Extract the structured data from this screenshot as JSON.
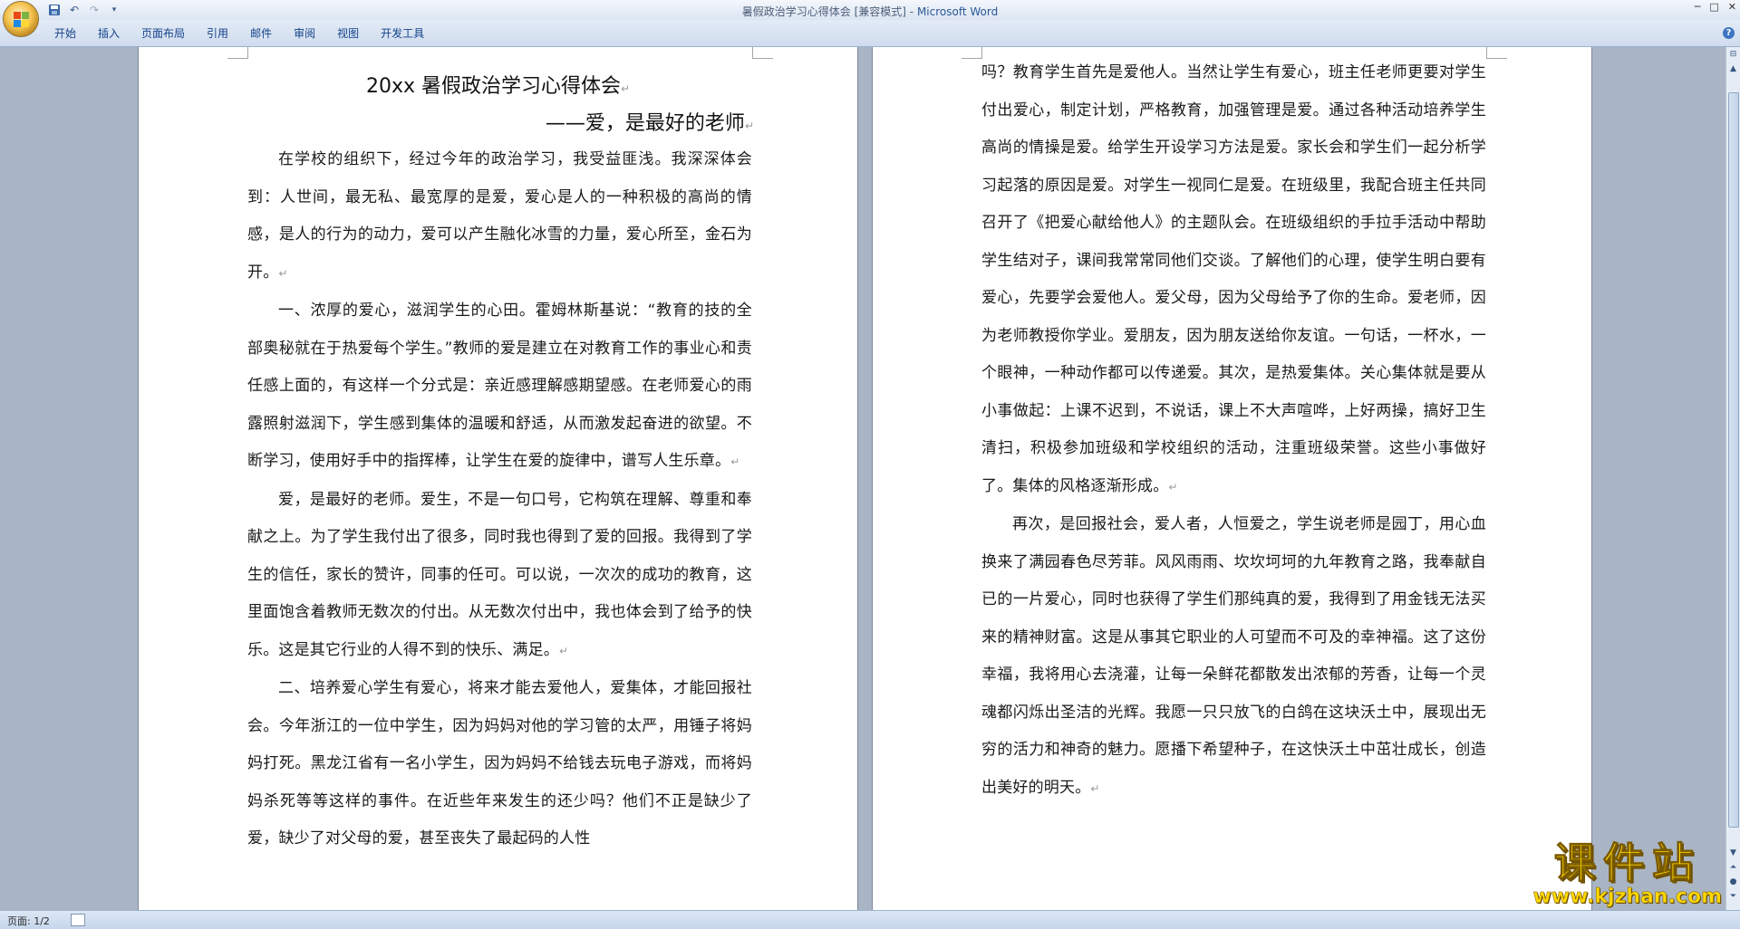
{
  "window": {
    "title": "暑假政治学习心得体会 [兼容模式]",
    "title_separator": " - ",
    "app_name": "Microsoft Word"
  },
  "ribbon_tabs": [
    "开始",
    "插入",
    "页面布局",
    "引用",
    "邮件",
    "审阅",
    "视图",
    "开发工具"
  ],
  "page1": {
    "title": "20xx 暑假政治学习心得体会",
    "subtitle": "——爱，是最好的老师",
    "paragraphs": [
      "在学校的组织下，经过今年的政治学习，我受益匪浅。我深深体会到：人世间，最无私、最宽厚的是爱，爱心是人的一种积极的高尚的情感，是人的行为的动力，爱可以产生融化冰雪的力量，爱心所至，金石为开。",
      "一、浓厚的爱心，滋润学生的心田。霍姆林斯基说：“教育的技的全部奥秘就在于热爱每个学生。”教师的爱是建立在对教育工作的事业心和责任感上面的，有这样一个分式是：亲近感理解感期望感。在老师爱心的雨露照射滋润下，学生感到集体的温暖和舒适，从而激发起奋进的欲望。不断学习，使用好手中的指挥棒，让学生在爱的旋律中，谱写人生乐章。",
      "爱，是最好的老师。爱生，不是一句口号，它构筑在理解、尊重和奉献之上。为了学生我付出了很多，同时我也得到了爱的回报。我得到了学生的信任，家长的赞许，同事的任可。可以说，一次次的成功的教育，这里面饱含着教师无数次的付出。从无数次付出中，我也体会到了给予的快乐。这是其它行业的人得不到的快乐、满足。",
      "二、培养爱心学生有爱心，将来才能去爱他人，爱集体，才能回报社会。今年浙江的一位中学生，因为妈妈对他的学习管的太严，用锤子将妈妈打死。黑龙江省有一名小学生，因为妈妈不给钱去玩电子游戏，而将妈妈杀死等等这样的事件。在近些年来发生的还少吗？他们不正是缺少了爱，缺少了对父母的爱，甚至丧失了最起码的人性"
    ]
  },
  "page2": {
    "paragraphs": [
      "吗？教育学生首先是爱他人。当然让学生有爱心，班主任老师更要对学生付出爱心，制定计划，严格教育，加强管理是爱。通过各种活动培养学生高尚的情操是爱。给学生开设学习方法是爱。家长会和学生们一起分析学习起落的原因是爱。对学生一视同仁是爱。在班级里，我配合班主任共同召开了《把爱心献给他人》的主题队会。在班级组织的手拉手活动中帮助学生结对子，课间我常常同他们交谈。了解他们的心理，使学生明白要有爱心，先要学会爱他人。爱父母，因为父母给予了你的生命。爱老师，因为老师教授你学业。爱朋友，因为朋友送给你友谊。一句话，一杯水，一个眼神，一种动作都可以传递爱。其次，是热爱集体。关心集体就是要从小事做起：上课不迟到，不说话，课上不大声喧哗，上好两操，搞好卫生清扫，积极参加班级和学校组织的活动，注重班级荣誉。这些小事做好了。集体的风格逐渐形成。",
      "再次，是回报社会，爱人者，人恒爱之，学生说老师是园丁，用心血换来了满园春色尽芳菲。风风雨雨、坎坎坷坷的九年教育之路，我奉献自已的一片爱心，同时也获得了学生们那纯真的爱，我得到了用金钱无法买来的精神财富。这是从事其它职业的人可望而不可及的幸神福。这了这份幸福，我将用心去浇灌，让每一朵鲜花都散发出浓郁的芳香，让每一个灵魂都闪烁出圣洁的光辉。我愿一只只放飞的白鸽在这块沃土中，展现出无穷的活力和神奇的魅力。愿播下希望种子，在这快沃土中茁壮成长，创造出美好的明天。"
    ]
  },
  "paragraph_mark": "↵",
  "status_bar": {
    "page": "页面: 1/2"
  },
  "watermark": {
    "main": "课件站",
    "url": "www.kjzhan.com"
  },
  "colors": {
    "workspace": "#a9b5c4",
    "ribbon_text": "#15428b",
    "watermark": "#ffd800"
  },
  "icons": [
    "office-button-icon",
    "save-icon",
    "undo-icon",
    "redo-icon",
    "customize-qat-icon",
    "minimize-icon",
    "maximize-icon",
    "close-icon",
    "help-icon",
    "scroll-up-icon",
    "scroll-down-icon",
    "ruler-toggle-icon",
    "prev-page-icon",
    "next-page-icon",
    "select-browse-icon",
    "view-layout-icon"
  ]
}
